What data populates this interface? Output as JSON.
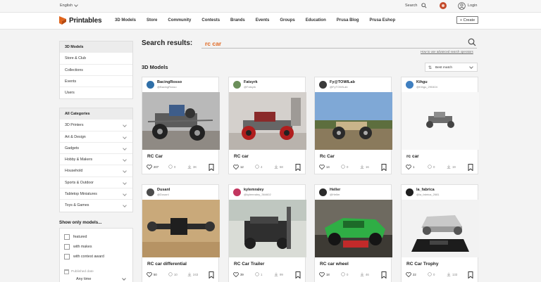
{
  "topbar": {
    "language": "English",
    "search": "Search",
    "login": "Login"
  },
  "nav": {
    "logo": "Printables",
    "items": [
      "3D Models",
      "Store",
      "Community",
      "Contests",
      "Brands",
      "Events",
      "Groups",
      "Education",
      "Prusa Blog",
      "Prusa Eshop"
    ],
    "create": "+ Create"
  },
  "sidebar": {
    "types": [
      "3D Models",
      "Store & Club",
      "Collections",
      "Events",
      "Users"
    ],
    "categories": [
      "All Categories",
      "3D Printers",
      "Art & Design",
      "Gadgets",
      "Hobby & Makers",
      "Household",
      "Sports & Outdoor",
      "Tabletop Miniatures",
      "Toys & Games"
    ],
    "show_only": "Show only models...",
    "filters": [
      "featured",
      "with makes",
      "with contest award"
    ],
    "published_label": "Published date",
    "published_value": "Any time"
  },
  "search": {
    "label": "Search results:",
    "query": "rc car",
    "advanced": "How to use advanced search operators"
  },
  "section_title": "3D Models",
  "sort": {
    "label": "Best match"
  },
  "colors": {
    "accent": "#e0651d",
    "bell": "#c44a2b"
  },
  "cards": [
    {
      "user": "BacingRosso",
      "handle": "@BacingRosso",
      "title": "RC Car",
      "likes": "207",
      "makes": "0",
      "downloads": "3K"
    },
    {
      "user": "Fatsyrk",
      "handle": "@Fatsyrk",
      "title": "RC car",
      "likes": "12",
      "makes": "4",
      "downloads": "58"
    },
    {
      "user": "Fy@TOWILab",
      "handle": "@FyTOWILab",
      "title": "Rc Car",
      "likes": "14",
      "makes": "0",
      "downloads": "16"
    },
    {
      "user": "Kihgu",
      "handle": "@Kihgu_290404",
      "title": "rc car",
      "likes": "1",
      "makes": "0",
      "downloads": "19"
    },
    {
      "user": "Dusanl",
      "handle": "@Dusanl",
      "title": "RC car differential",
      "likes": "50",
      "makes": "10",
      "downloads": "243"
    },
    {
      "user": "kylemraley",
      "handle": "@kylemraley_364602",
      "title": "RC Car Trailer",
      "likes": "39",
      "makes": "1",
      "downloads": "99"
    },
    {
      "user": "Heller",
      "handle": "@Heller",
      "title": "RC car wheel",
      "likes": "18",
      "makes": "0",
      "downloads": "46"
    },
    {
      "user": "la_fabrica",
      "handle": "@la_fabrica_2681",
      "title": "RC Car Trophy",
      "likes": "22",
      "makes": "0",
      "downloads": "133"
    }
  ]
}
